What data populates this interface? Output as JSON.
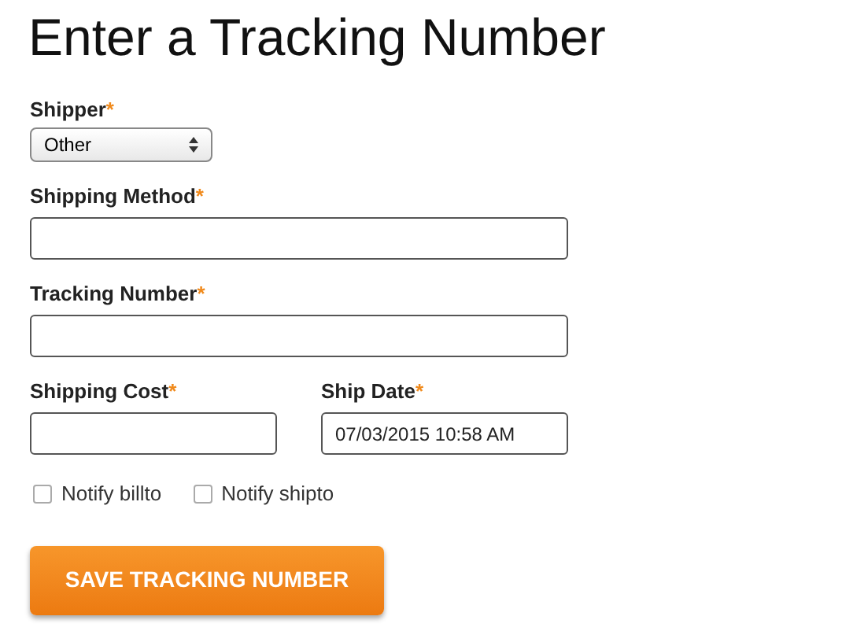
{
  "title": "Enter a Tracking Number",
  "fields": [
    {
      "kind": "select",
      "label": "Shipper",
      "mark": "*",
      "value": "Other"
    },
    {
      "kind": "text",
      "label": "Shipping Method",
      "mark": "*"
    },
    {
      "kind": "text",
      "label": "Tracking Number",
      "mark": "*"
    }
  ],
  "pair": [
    {
      "kind": "text",
      "label": "Shipping Cost",
      "mark": "*"
    },
    {
      "kind": "text",
      "label": "Ship Date",
      "mark": "*",
      "value": "07/03/2015 10:58 AM"
    }
  ],
  "checkboxes": [
    {
      "label": "Notify billto",
      "checked": false
    },
    {
      "label": "Notify shipto",
      "checked": false
    }
  ],
  "button": "SAVE TRACKING NUMBER"
}
